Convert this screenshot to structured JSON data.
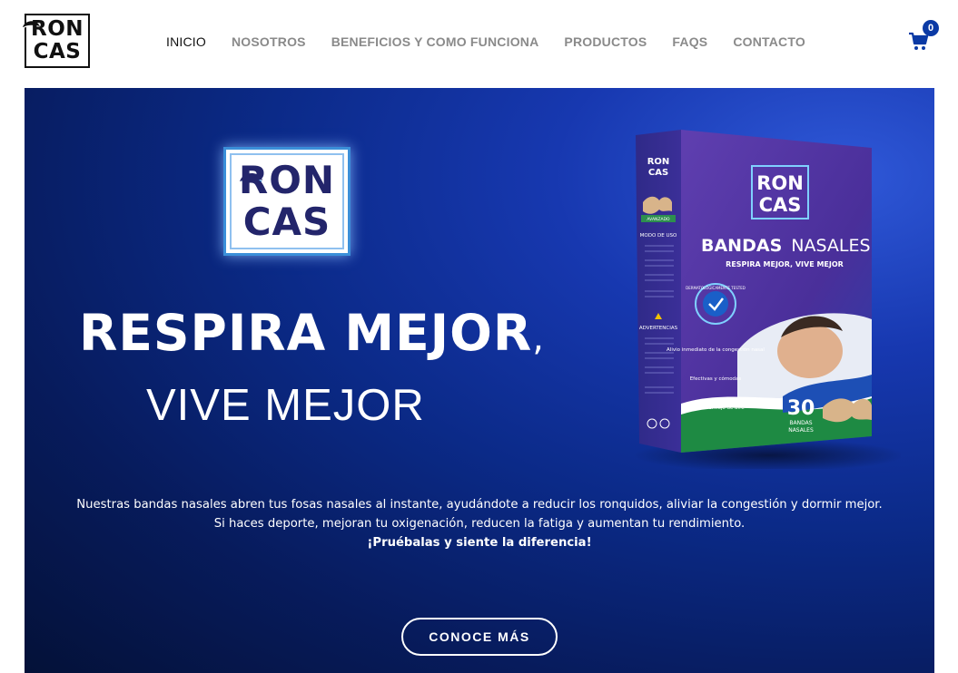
{
  "brand": {
    "logo_line1": "RON",
    "logo_line2": "CAS"
  },
  "nav": {
    "items": [
      {
        "label": "INICIO",
        "active": true
      },
      {
        "label": "NOSOTROS",
        "active": false
      },
      {
        "label": "BENEFICIOS Y COMO FUNCIONA",
        "active": false
      },
      {
        "label": "PRODUCTOS",
        "active": false
      },
      {
        "label": "FAQS",
        "active": false
      },
      {
        "label": "CONTACTO",
        "active": false
      }
    ]
  },
  "cart": {
    "icon": "cart-icon",
    "count": "0"
  },
  "hero": {
    "logo_line1": "RON",
    "logo_line2": "CAS",
    "headline": "RESPIRA MEJOR",
    "headline_comma": ",",
    "subhead": "VIVE MEJOR",
    "description_line1": "Nuestras bandas nasales abren tus fosas nasales al instante, ayudándote a reducir los ronquidos, aliviar la congestión y dormir mejor.",
    "description_line2": "Si haces deporte, mejoran tu oxigenación, reducen la fatiga y aumentan tu rendimiento.",
    "description_bold": "¡Pruébalas y siente la diferencia!",
    "cta_label": "CONOCE MÁS"
  },
  "product_box": {
    "brand_line1": "RON",
    "brand_line2": "CAS",
    "title_bold": "BANDAS",
    "title_light": "NASALES",
    "tagline": "RESPIRA MEJOR, VIVE MEJOR",
    "side_label": "AVANZADO",
    "side_modo": "MODO DE USO",
    "side_adv": "ADVERTENCIAS",
    "seal_text": "DERMATOLÓGICAMENTE TESTED",
    "benefit1": "Alivio inmediato de la congestión nasal",
    "benefit2": "Efectivas y cómodas",
    "benefit3": "Mejoran el flujo de aire",
    "count_number": "30",
    "count_label_1": "BANDAS",
    "count_label_2": "NASALES"
  },
  "colors": {
    "accent": "#0b3aa5",
    "hero_dark": "#041138",
    "hero_light": "#2f58d8",
    "logo_navy": "#23256b"
  }
}
